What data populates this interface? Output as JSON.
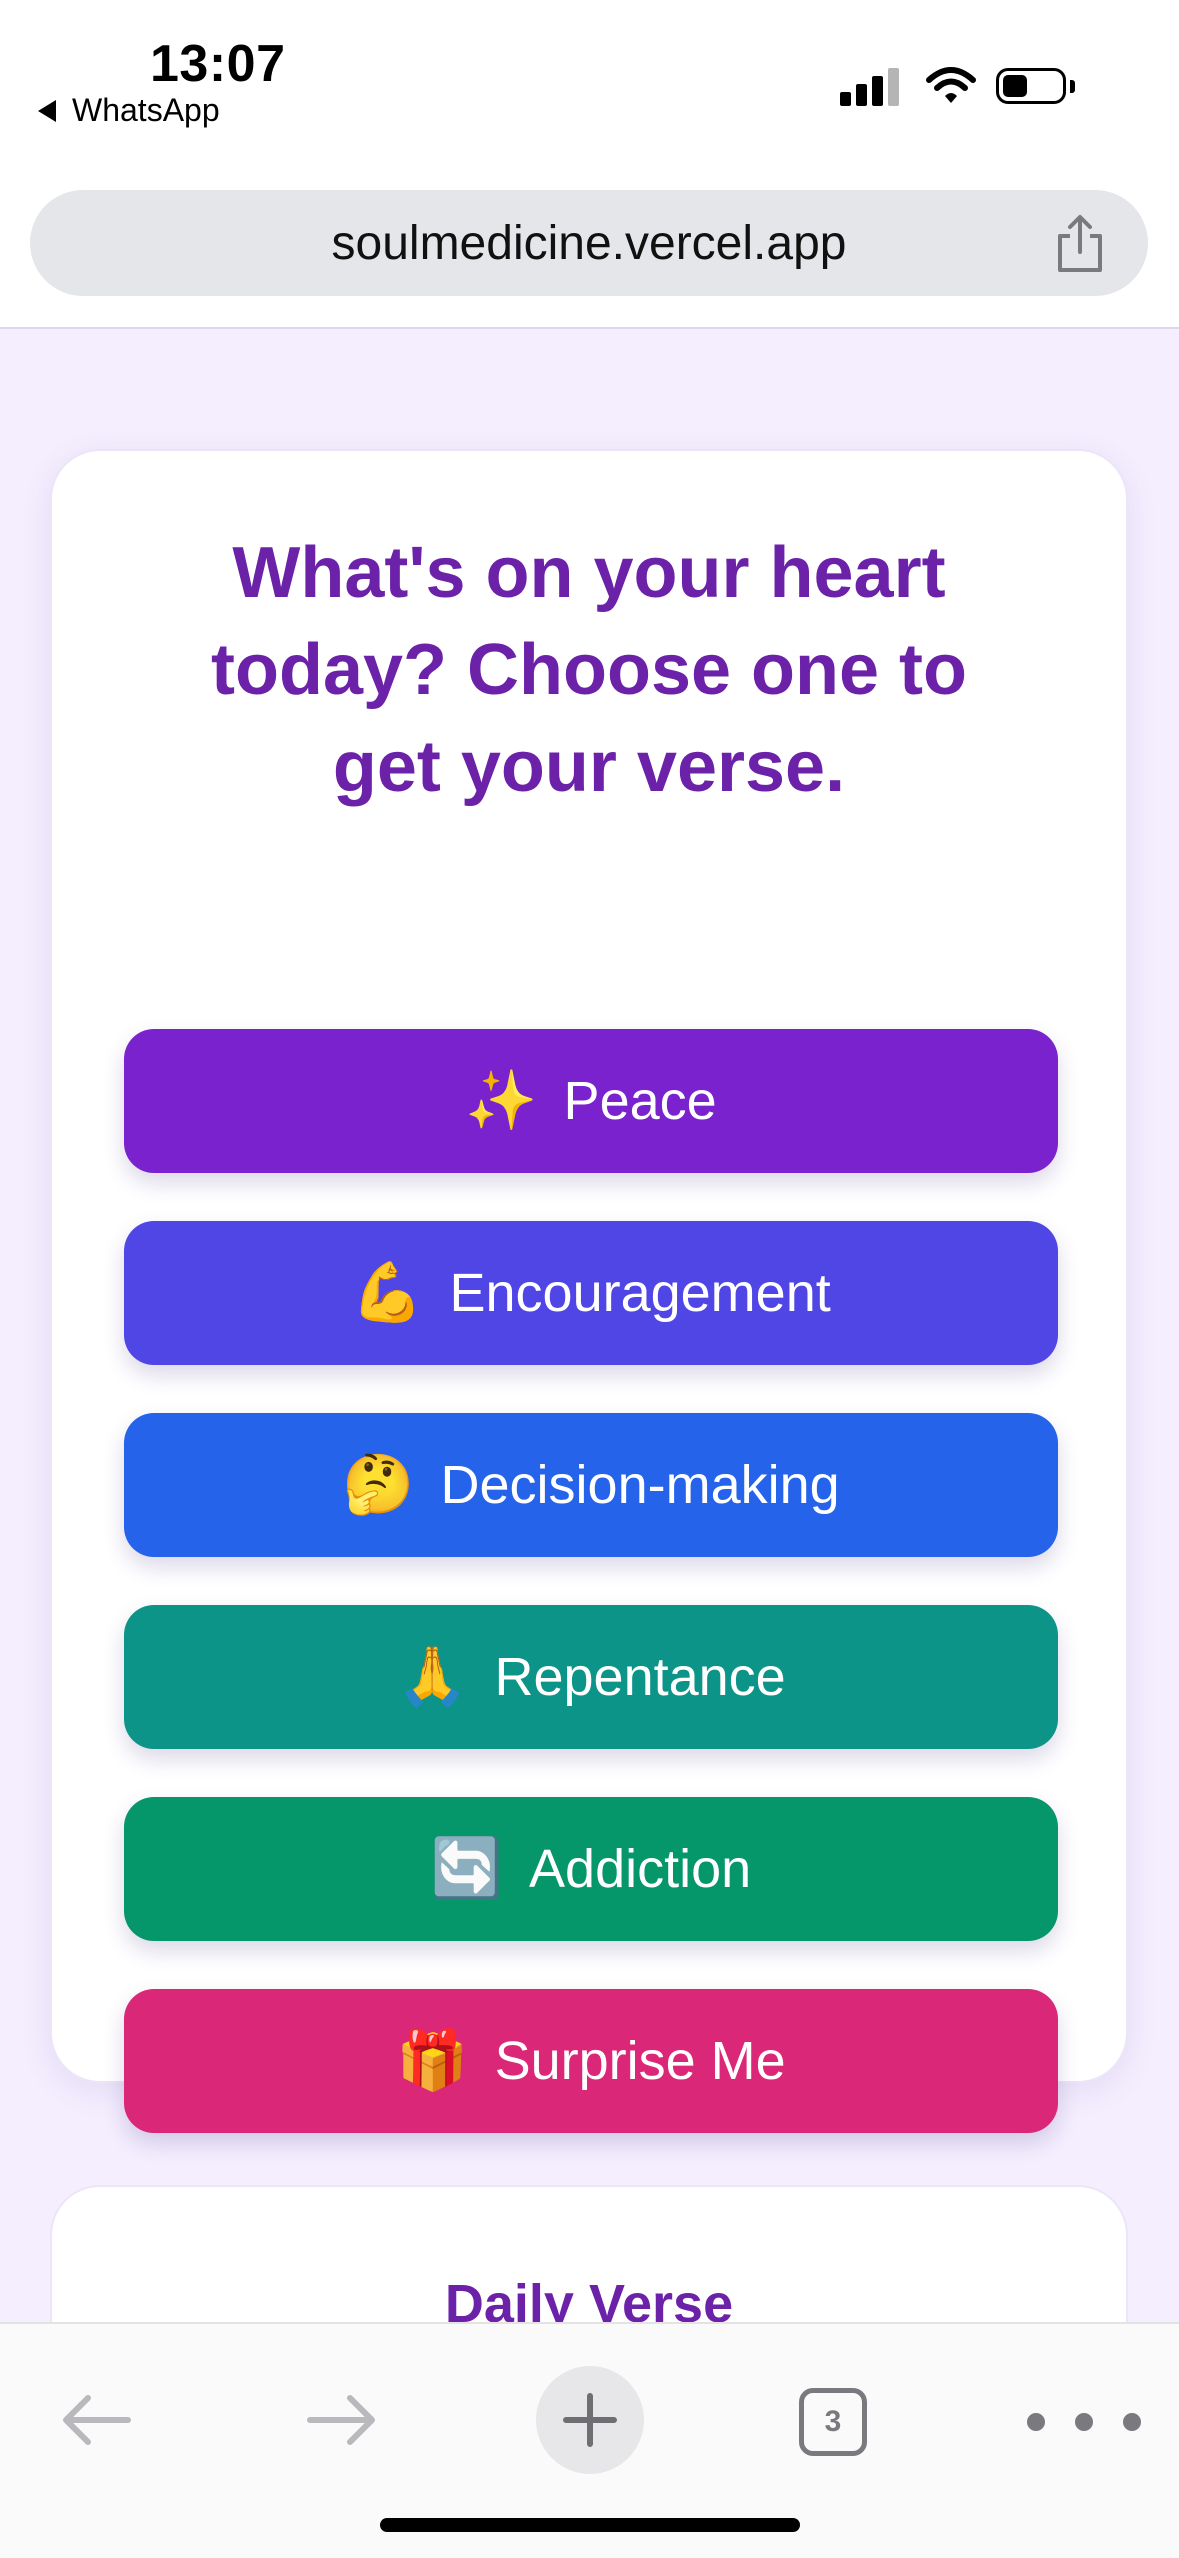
{
  "status_bar": {
    "time": "13:07",
    "back_app": "WhatsApp",
    "icons": [
      "cellular-signal-icon",
      "wifi-icon",
      "battery-icon"
    ]
  },
  "browser": {
    "url": "soulmedicine.vercel.app",
    "tab_count": "3"
  },
  "main": {
    "title": "What's on your heart today? Choose one to get your verse.",
    "buttons": [
      {
        "emoji": "✨",
        "label": "Peace",
        "color": "#7b22cf"
      },
      {
        "emoji": "💪",
        "label": "Encouragement",
        "color": "#4f46e5"
      },
      {
        "emoji": "🤔",
        "label": "Decision-making",
        "color": "#2563eb"
      },
      {
        "emoji": "🙏",
        "label": "Repentance",
        "color": "#0d9488"
      },
      {
        "emoji": "🔄",
        "label": "Addiction",
        "color": "#059669"
      },
      {
        "emoji": "🎁",
        "label": "Surprise Me",
        "color": "#db2777"
      }
    ]
  },
  "daily_verse": {
    "title": "Daily Verse"
  },
  "colors": {
    "title_purple": "#6b21a8",
    "page_background": "#f4eefe"
  }
}
